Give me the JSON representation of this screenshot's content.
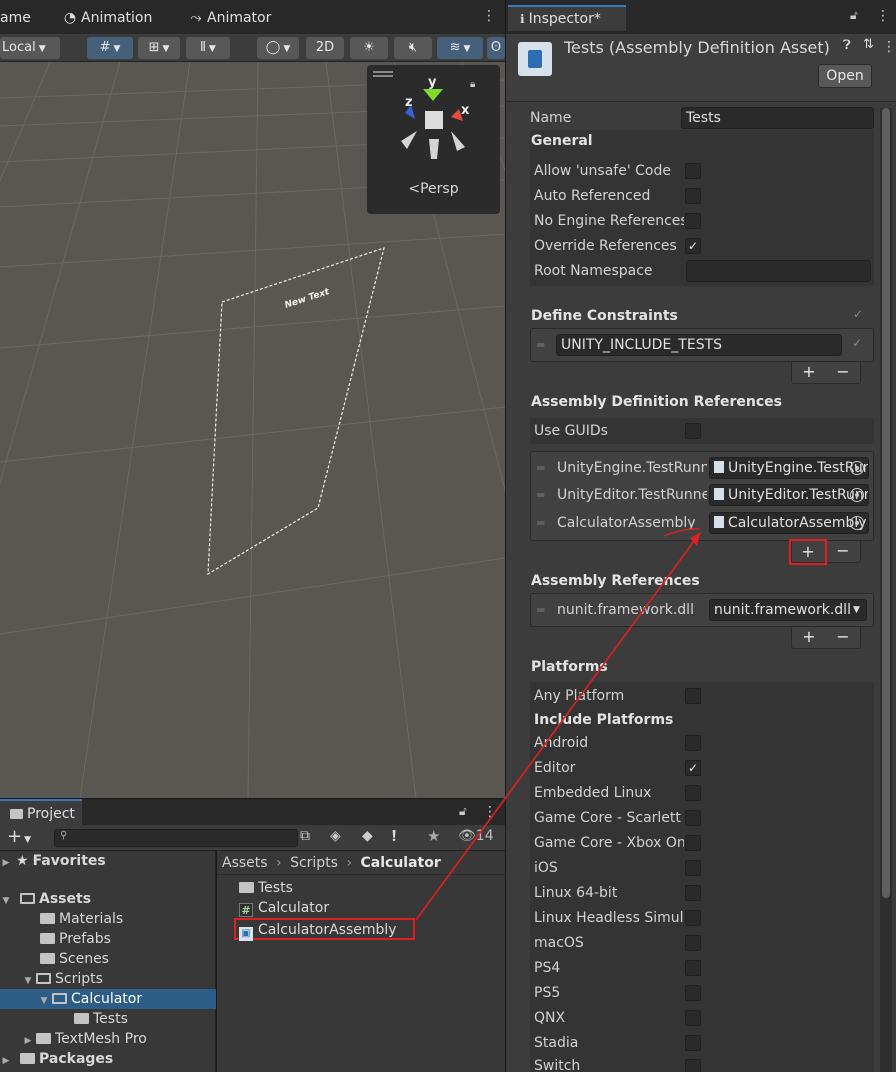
{
  "scene_tabs": [
    {
      "icon": "game-tab",
      "label": "ame"
    },
    {
      "icon": "clock-icon",
      "label": "Animation"
    },
    {
      "icon": "animator-icon",
      "label": "Animator"
    }
  ],
  "scene_toolbar": {
    "pivot_space": "Local",
    "mode_2d": "2D"
  },
  "gizmo": {
    "axis_x": "x",
    "axis_y": "y",
    "axis_z": "z",
    "projection": "<Persp"
  },
  "scene_object_text": "New Text",
  "project": {
    "tab_label": "Project",
    "add_label": "+",
    "visible_count": "14",
    "tree": [
      {
        "label": "Favorites",
        "bold": true
      },
      {
        "label": "Assets",
        "bold": true
      },
      {
        "label": "Materials"
      },
      {
        "label": "Prefabs"
      },
      {
        "label": "Scenes"
      },
      {
        "label": "Scripts"
      },
      {
        "label": "Calculator",
        "selected": true
      },
      {
        "label": "Tests"
      },
      {
        "label": "TextMesh Pro"
      },
      {
        "label": "Packages",
        "bold": true
      }
    ],
    "breadcrumb": [
      "Assets",
      "Scripts",
      "Calculator"
    ],
    "files": [
      {
        "icon": "folder-icon",
        "label": "Tests"
      },
      {
        "icon": "csharp-script-icon",
        "label": "Calculator"
      },
      {
        "icon": "assembly-definition-icon",
        "label": "CalculatorAssembly"
      }
    ]
  },
  "inspector": {
    "tab_label": "Inspector*",
    "title": "Tests (Assembly Definition Asset)",
    "open_label": "Open",
    "name_label": "Name",
    "name_value": "Tests",
    "general_header": "General",
    "general": [
      {
        "label": "Allow 'unsafe' Code",
        "checked": false
      },
      {
        "label": "Auto Referenced",
        "checked": false
      },
      {
        "label": "No Engine References",
        "checked": false
      },
      {
        "label": "Override References",
        "checked": true
      }
    ],
    "root_namespace_label": "Root Namespace",
    "root_namespace_value": "",
    "define_constraints_header": "Define Constraints",
    "define_constraints": [
      "UNITY_INCLUDE_TESTS"
    ],
    "asm_def_refs_header": "Assembly Definition References",
    "use_guids_label": "Use GUIDs",
    "use_guids_checked": false,
    "asm_def_refs": [
      {
        "label": "UnityEngine.TestRunner",
        "value": "UnityEngine.TestRunner"
      },
      {
        "label": "UnityEditor.TestRunner",
        "value": "UnityEditor.TestRunner"
      },
      {
        "label": "CalculatorAssembly",
        "value": "CalculatorAssembly"
      }
    ],
    "asm_refs_header": "Assembly References",
    "asm_refs": [
      {
        "label": "nunit.framework.dll",
        "value": "nunit.framework.dll"
      }
    ],
    "plus": "+",
    "minus": "−",
    "checkmark": "✓",
    "platforms_header": "Platforms",
    "any_platform_label": "Any Platform",
    "any_platform_checked": false,
    "include_platforms_header": "Include Platforms",
    "platforms": [
      {
        "label": "Android",
        "checked": false
      },
      {
        "label": "Editor",
        "checked": true
      },
      {
        "label": "Embedded Linux",
        "checked": false
      },
      {
        "label": "Game Core - Scarlett",
        "checked": false
      },
      {
        "label": "Game Core - Xbox One",
        "checked": false
      },
      {
        "label": "iOS",
        "checked": false
      },
      {
        "label": "Linux 64-bit",
        "checked": false
      },
      {
        "label": "Linux Headless Simulation",
        "checked": false
      },
      {
        "label": "macOS",
        "checked": false
      },
      {
        "label": "PS4",
        "checked": false
      },
      {
        "label": "PS5",
        "checked": false
      },
      {
        "label": "QNX",
        "checked": false
      },
      {
        "label": "Stadia",
        "checked": false
      },
      {
        "label": "Switch",
        "checked": false
      }
    ]
  },
  "colors": {
    "highlight": "#e02020",
    "accent": "#3a79bb",
    "selection": "#2c5d87"
  }
}
